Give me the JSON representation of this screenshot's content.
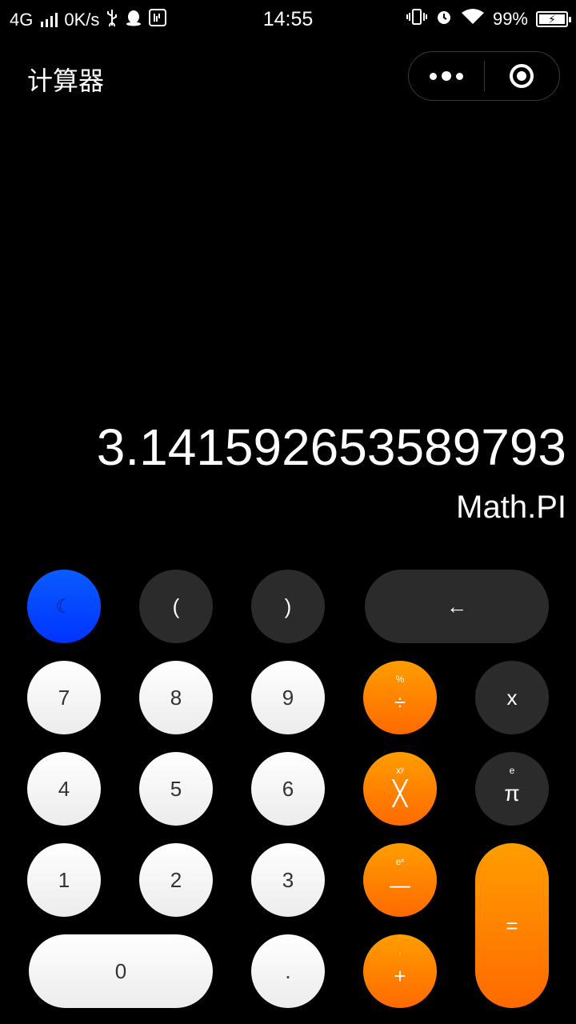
{
  "status_bar": {
    "network": "4G",
    "speed": "0K/s",
    "time": "14:55",
    "battery": "99%"
  },
  "header": {
    "title": "计算器"
  },
  "display": {
    "result": "3.141592653589793",
    "expression": "Math.PI"
  },
  "keys": {
    "theme": "☾",
    "paren_open": "(",
    "paren_close": ")",
    "backspace": "←",
    "seven": "7",
    "eight": "8",
    "nine": "9",
    "divide": "÷",
    "divide_alt": "%",
    "clear": "x",
    "four": "4",
    "five": "5",
    "six": "6",
    "multiply": "╳",
    "multiply_alt": "xʸ",
    "pi": "π",
    "pi_alt": "e",
    "one": "1",
    "two": "2",
    "three": "3",
    "minus": "—",
    "minus_alt": "eˣ",
    "equals": "=",
    "zero": "0",
    "dot": ".",
    "plus": "+",
    "plus_alt": "·"
  },
  "colors": {
    "background": "#000000",
    "operator_orange": "#ff7d00",
    "theme_blue": "#0033ff",
    "function_dark": "#2b2b2b",
    "digit_white": "#ffffff"
  }
}
